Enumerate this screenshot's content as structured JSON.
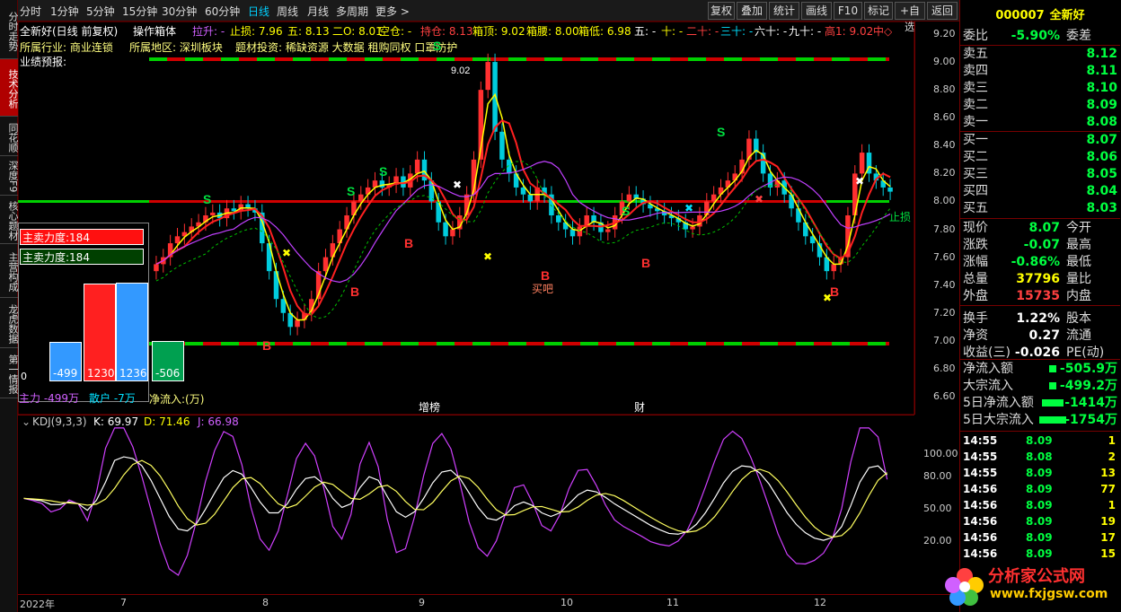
{
  "vtabs": [
    "分时走势",
    "技术分析",
    "同花顺",
    "深度F9",
    "核心题材",
    "主营构成",
    "龙虎数据",
    "第一情报"
  ],
  "timeframes": [
    "分时",
    "1分钟",
    "5分钟",
    "15分钟",
    "30分钟",
    "60分钟",
    "日线",
    "周线",
    "月线",
    "多周期",
    "更多 >"
  ],
  "toolbar": [
    "复权",
    "叠加",
    "统计",
    "画线",
    "F10",
    "标记",
    "+自选",
    "返回"
  ],
  "info": {
    "stock_title": "全新好(日线 前复权)",
    "indicator": "操作箱体",
    "lasheng": "拉升: -",
    "zhisun": "止损: 7.96",
    "wu": "五: 8.13",
    "er": "二O: 8.01",
    "kongcang": "空仓: -",
    "chicang": "持仓: 8.13",
    "xiangding": "箱顶: 9.02",
    "xiangyao": "箱腰: 8.00",
    "xiangdi": "箱低: 6.98",
    "wu2": "五: -",
    "shi": "十: -",
    "ershi": "二十: -",
    "sanshi": "三十: -",
    "liushi": "六十: -",
    "jiushi": "九十: -",
    "gao1": "高1: 9.02",
    "zhong": "中◇",
    "industry": "所属行业: 商业连锁",
    "region": "所属地区: 深圳板块",
    "themes": "题材投资: 稀缺资源 大数据 租购同权 口罩防护",
    "earnings": "业绩预报:"
  },
  "price_axis": [
    "9.20",
    "9.00",
    "8.80",
    "8.60",
    "8.40",
    "8.20",
    "8.00",
    "7.80",
    "7.60",
    "7.40",
    "7.20",
    "7.00",
    "6.80",
    "6.60"
  ],
  "kdj_axis": [
    "100.00",
    "80.00",
    "50.00",
    "20.00"
  ],
  "kdj_title": {
    "name": "KDJ(9,3,3)",
    "k": "K: 69.97",
    "d": "D: 71.46",
    "j": "J: 66.98"
  },
  "time_axis": [
    "2022年",
    "7",
    "8",
    "9",
    "10",
    "11",
    "12"
  ],
  "markers": {
    "s": "S",
    "b": "B",
    "buy": "买吧",
    "high": "9.02",
    "stoploss": "止损",
    "zengchi": "增榜",
    "cai": "财"
  },
  "fund": {
    "legend1": "主卖力度:184",
    "legend2": "主卖力度:184",
    "bars": [
      {
        "label": "-499",
        "value": -499,
        "color": "#3399ff"
      },
      {
        "label": "1230",
        "value": 1230,
        "color": "#ff2020"
      },
      {
        "label": "1236",
        "value": 1236,
        "color": "#3399ff"
      },
      {
        "label": "-506",
        "value": -506,
        "color": "#00a050"
      }
    ],
    "zero": "0",
    "foot1": "主力 -499万",
    "foot2": "散户 -7万",
    "foot3": "净流入:(万)"
  },
  "quote": {
    "code": "000007",
    "name": "全新好",
    "weibi_label": "委比",
    "weibi": "-5.90%",
    "weicha_label": "委差",
    "asks": [
      {
        "l": "卖五",
        "v": "8.12"
      },
      {
        "l": "卖四",
        "v": "8.11"
      },
      {
        "l": "卖三",
        "v": "8.10"
      },
      {
        "l": "卖二",
        "v": "8.09"
      },
      {
        "l": "卖一",
        "v": "8.08"
      }
    ],
    "bids": [
      {
        "l": "买一",
        "v": "8.07"
      },
      {
        "l": "买二",
        "v": "8.06"
      },
      {
        "l": "买三",
        "v": "8.05"
      },
      {
        "l": "买四",
        "v": "8.04"
      },
      {
        "l": "买五",
        "v": "8.03"
      }
    ],
    "stats": [
      {
        "l": "现价",
        "v": "8.07",
        "c": "green",
        "l2": "今开"
      },
      {
        "l": "涨跌",
        "v": "-0.07",
        "c": "green",
        "l2": "最高"
      },
      {
        "l": "涨幅",
        "v": "-0.86%",
        "c": "green",
        "l2": "最低"
      },
      {
        "l": "总量",
        "v": "37796",
        "c": "yellow",
        "l2": "量比"
      },
      {
        "l": "外盘",
        "v": "15735",
        "c": "red",
        "l2": "内盘"
      },
      {
        "l": "换手",
        "v": "1.22%",
        "c": "white",
        "l2": "股本"
      },
      {
        "l": "净资",
        "v": "0.27",
        "c": "white",
        "l2": "流通"
      },
      {
        "l": "收益(三)",
        "v": "-0.026",
        "c": "white",
        "l2": "PE(动)"
      }
    ],
    "flows": [
      {
        "l": "净流入额",
        "v": "-505.9万",
        "bar": 8
      },
      {
        "l": "大宗流入",
        "v": "-499.2万",
        "bar": 8
      },
      {
        "l": "5日净流入额",
        "v": "-1414万",
        "bar": 24
      },
      {
        "l": "5日大宗流入",
        "v": "-1754万",
        "bar": 30
      }
    ],
    "ticks": [
      {
        "t": "14:55",
        "p": "8.09",
        "v": "1"
      },
      {
        "t": "14:55",
        "p": "8.08",
        "v": "2"
      },
      {
        "t": "14:55",
        "p": "8.09",
        "v": "13"
      },
      {
        "t": "14:56",
        "p": "8.09",
        "v": "77"
      },
      {
        "t": "14:56",
        "p": "8.09",
        "v": "1"
      },
      {
        "t": "14:56",
        "p": "8.09",
        "v": "19"
      },
      {
        "t": "14:56",
        "p": "8.09",
        "v": "17"
      },
      {
        "t": "14:56",
        "p": "8.09",
        "v": "15"
      }
    ]
  },
  "logo": {
    "text": "分析家公式网",
    "url": "www.fxjgsw.com"
  },
  "colors": {
    "up": "#ff3030",
    "down": "#00ccdd",
    "box_line": "#ff0000",
    "green_line": "#00d000"
  }
}
